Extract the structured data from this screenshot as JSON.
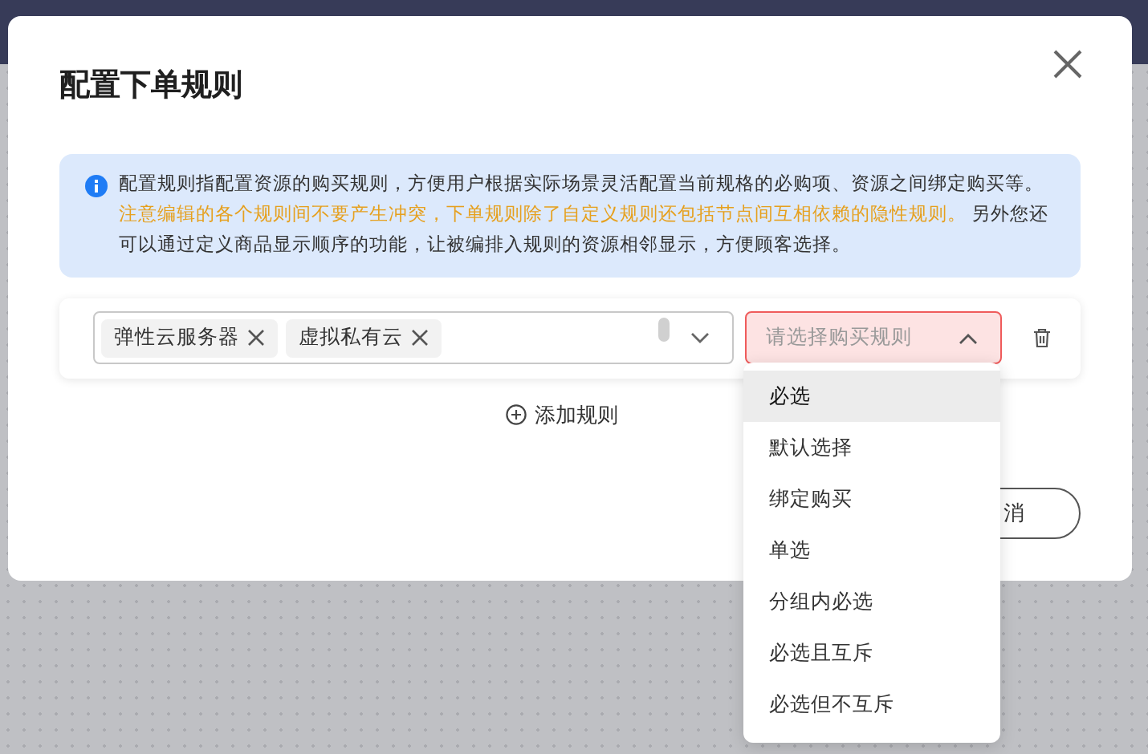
{
  "dialog": {
    "title": "配置下单规则",
    "notice": [
      {
        "kind": "normal",
        "text": "配置规则指配置资源的购买规则，方便用户根据实际场景灵活配置当前规格的必购项、资源之间绑定购买等。"
      },
      {
        "kind": "warning",
        "text": "注意编辑的各个规则间不要产生冲突，下单规则除了自定义规则还包括节点间互相依赖的隐性规则。"
      },
      {
        "kind": "normal",
        "text": " 另外您还可以通过定义商品显示顺序的功能，让被编排入规则的资源相邻显示，方便顾客选择。"
      }
    ],
    "rule": {
      "resources": [
        "弹性云服务器",
        "虚拟私有云"
      ],
      "rule_select": {
        "placeholder": "请选择购买规则",
        "expanded": true,
        "invalid": true
      }
    },
    "add_rule": "添加规则",
    "cancel_button": "消"
  },
  "dropdown": [
    {
      "label": "必选",
      "selected": true
    },
    {
      "label": "默认选择",
      "selected": false
    },
    {
      "label": "绑定购买",
      "selected": false
    },
    {
      "label": "单选",
      "selected": false
    },
    {
      "label": "分组内必选",
      "selected": false
    },
    {
      "label": "必选且互斥",
      "selected": false
    },
    {
      "label": "必选但不互斥",
      "selected": false
    }
  ]
}
